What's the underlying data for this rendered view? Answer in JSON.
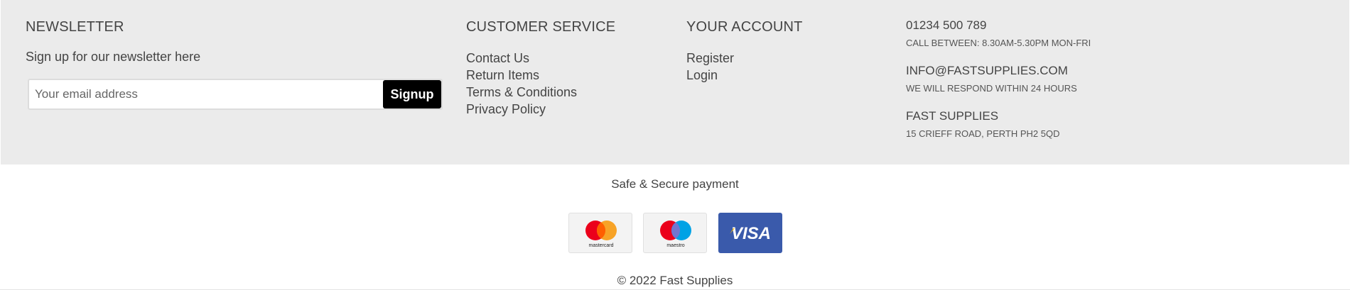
{
  "newsletter": {
    "title": "NEWSLETTER",
    "text": "Sign up for our newsletter here",
    "email_placeholder": "Your email address",
    "signup_label": "Signup"
  },
  "customer_service": {
    "title": "CUSTOMER SERVICE",
    "links": [
      "Contact Us",
      "Return Items",
      "Terms & Conditions",
      "Privacy Policy"
    ]
  },
  "your_account": {
    "title": "YOUR ACCOUNT",
    "links": [
      "Register",
      "Login"
    ]
  },
  "contact": {
    "phone": "01234 500 789",
    "phone_note": "CALL BETWEEN: 8.30AM-5.30PM MON-FRI",
    "email": "INFO@FASTSUPPLIES.COM",
    "email_note": "WE WILL RESPOND WITHIN 24 HOURS",
    "company": "FAST SUPPLIES",
    "address": "15 CRIEFF ROAD, PERTH PH2 5QD"
  },
  "payment": {
    "title": "Safe & Secure payment",
    "cards": [
      {
        "name": "mastercard",
        "icon": "mastercard-icon"
      },
      {
        "name": "maestro",
        "icon": "maestro-icon"
      },
      {
        "name": "VISA",
        "icon": "visa-icon"
      }
    ]
  },
  "copyright": "© 2022 Fast Supplies",
  "colors": {
    "footer_bg": "#ebebeb",
    "button_bg": "#000000",
    "visa_blue": "#3a5aab",
    "mc_red": "#eb001b",
    "mc_orange": "#f79e1b",
    "maestro_blue": "#00a2e5"
  }
}
